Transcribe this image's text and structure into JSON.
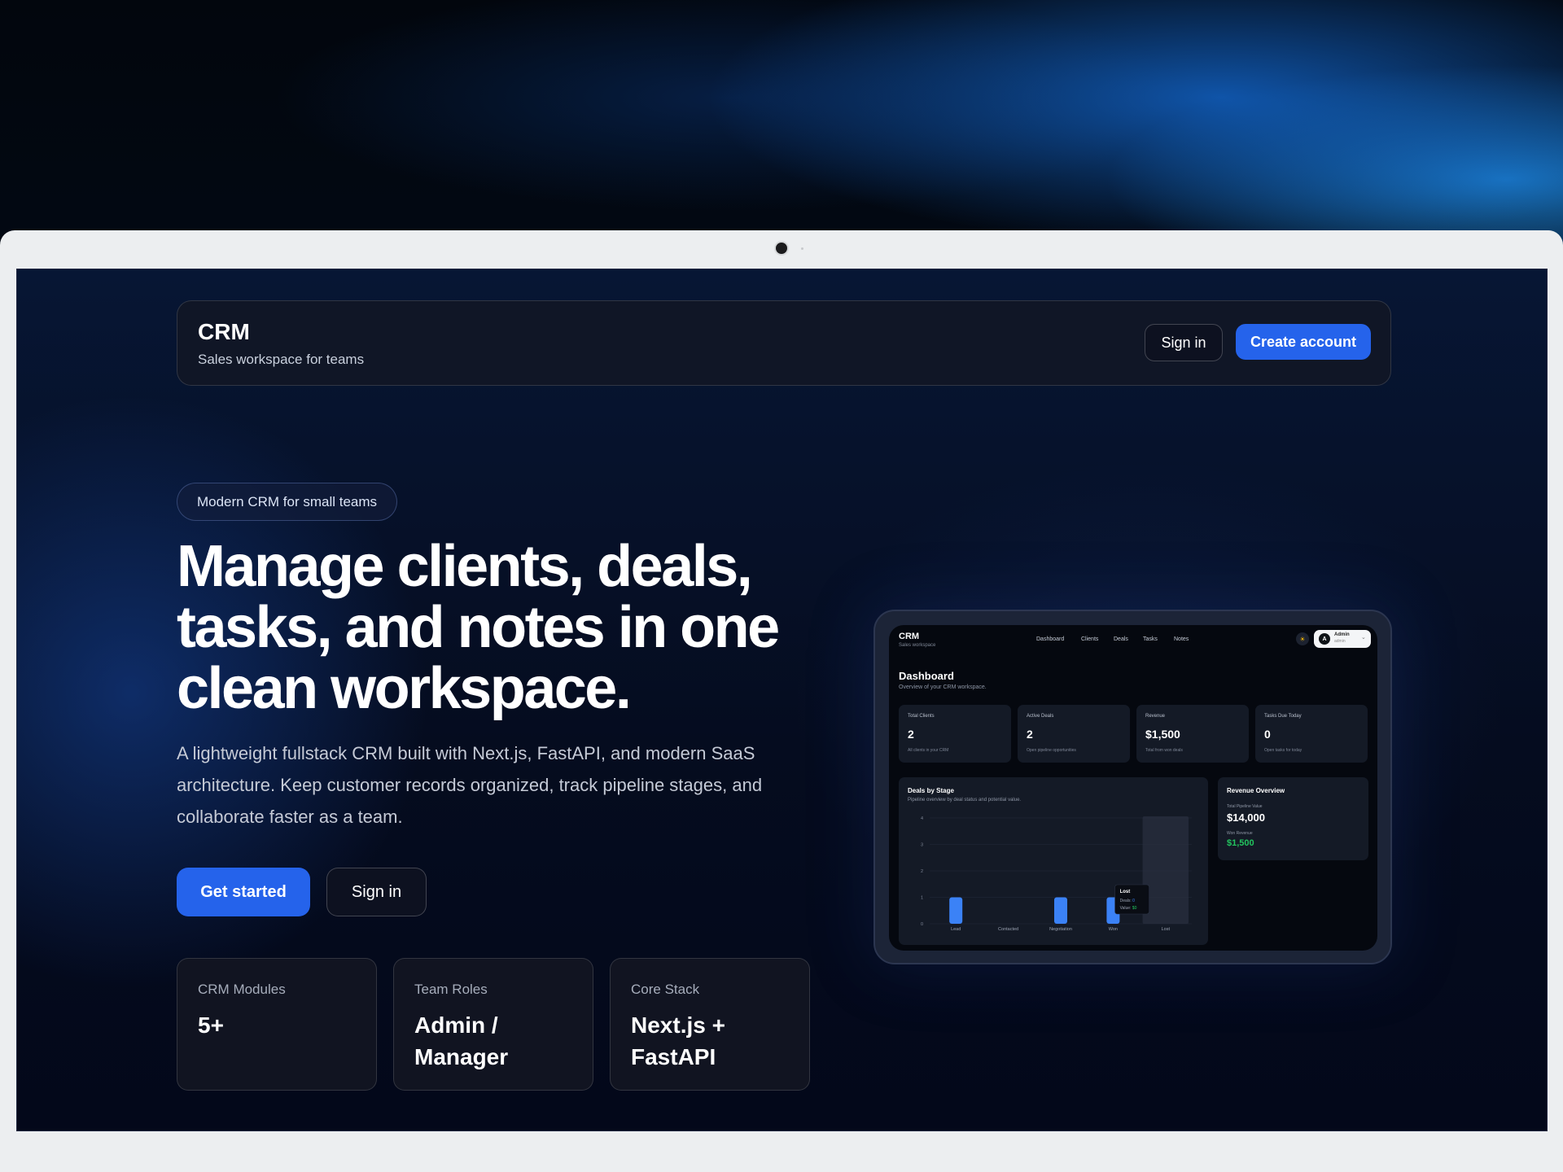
{
  "nav": {
    "brand_title": "CRM",
    "brand_subtitle": "Sales workspace for teams",
    "sign_in_label": "Sign in",
    "create_account_label": "Create account"
  },
  "hero": {
    "badge": "Modern CRM for small teams",
    "headline": "Manage clients, deals, tasks, and notes in one clean workspace.",
    "description": "A lightweight fullstack CRM built with Next.js, FastAPI, and modern SaaS architecture. Keep customer records organized, track pipeline stages, and collaborate faster as a team.",
    "get_started_label": "Get started",
    "sign_in_label": "Sign in"
  },
  "stats": [
    {
      "label": "CRM Modules",
      "value": "5+"
    },
    {
      "label": "Team Roles",
      "value": "Admin / Manager"
    },
    {
      "label": "Core Stack",
      "value": "Next.js + FastAPI"
    }
  ],
  "preview": {
    "brand_title": "CRM",
    "brand_subtitle": "Sales workspace",
    "nav": [
      "Dashboard",
      "Clients",
      "Deals",
      "Tasks",
      "Notes"
    ],
    "user_initial": "A",
    "user_name": "Admin",
    "user_role": "admin",
    "title": "Dashboard",
    "subtitle": "Overview of your CRM workspace.",
    "cards": [
      {
        "label": "Total Clients",
        "value": "2",
        "hint": "All clients in your CRM"
      },
      {
        "label": "Active Deals",
        "value": "2",
        "hint": "Open pipeline opportunities"
      },
      {
        "label": "Revenue",
        "value": "$1,500",
        "hint": "Total from won deals"
      },
      {
        "label": "Tasks Due Today",
        "value": "0",
        "hint": "Open tasks for today"
      }
    ],
    "deals_title": "Deals by Stage",
    "deals_subtitle": "Pipeline overview by deal status and potential value.",
    "revenue": {
      "title": "Revenue Overview",
      "pipeline_label": "Total Pipeline Value",
      "pipeline_value": "$14,000",
      "won_label": "Won Revenue",
      "won_value": "$1,500"
    }
  },
  "chart_data": {
    "type": "bar",
    "title": "Deals by Stage",
    "categories": [
      "Lead",
      "Contacted",
      "Negotiation",
      "Won",
      "Lost"
    ],
    "values": [
      1,
      0,
      1,
      1,
      0
    ],
    "ylim": [
      0,
      4
    ],
    "yticks": [
      0,
      1,
      2,
      3,
      4
    ],
    "bar_color": "#3b82f6",
    "tooltip": {
      "title": "Lost",
      "deals_label": "Deals:",
      "deals_value": "0",
      "value_label": "Value:",
      "value_value": "$0"
    }
  },
  "colors": {
    "primary": "#2563eb",
    "success": "#22c55e"
  }
}
